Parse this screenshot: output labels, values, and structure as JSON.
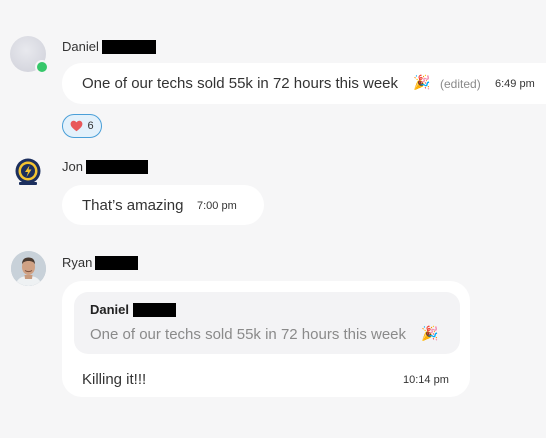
{
  "messages": [
    {
      "author": "Daniel",
      "text": "One of our techs sold 55k in 72 hours this week",
      "emoji": "🎉",
      "edited": "(edited)",
      "time": "6:49 pm",
      "reaction": {
        "icon": "heart",
        "count": "6"
      }
    },
    {
      "author": "Jon",
      "text": "That’s amazing",
      "time": "7:00 pm"
    },
    {
      "author": "Ryan",
      "quote": {
        "author": "Daniel",
        "text": "One of our techs sold 55k in 72 hours this week",
        "emoji": "🎉"
      },
      "text": "Killing it!!!",
      "time": "10:14 pm"
    }
  ],
  "colors": {
    "background": "#f6f6f7",
    "bubble": "#ffffff",
    "presence": "#36c76a",
    "reaction_border": "#4a9fd8",
    "reaction_fill": "#e3f1fb",
    "heart": "#e8585a"
  }
}
